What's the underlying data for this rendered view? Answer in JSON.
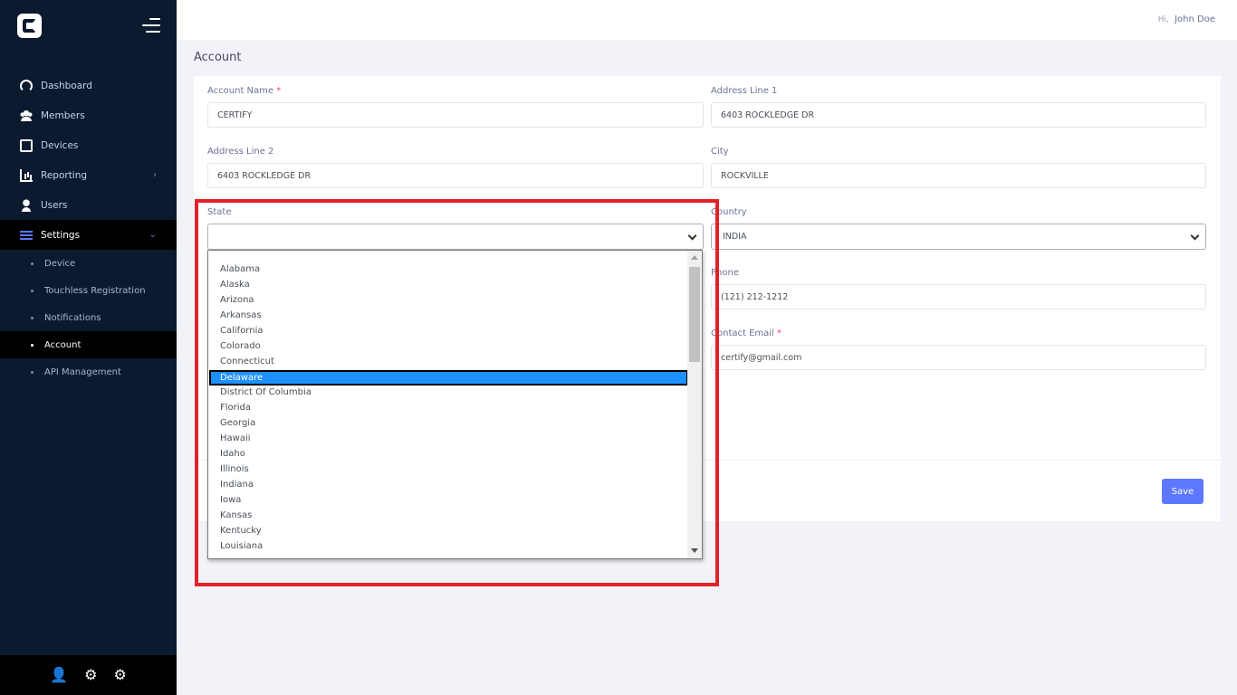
{
  "sidebar": {
    "nav": [
      {
        "label": "Dashboard",
        "icon": "dashboard-icon"
      },
      {
        "label": "Members",
        "icon": "members-icon"
      },
      {
        "label": "Devices",
        "icon": "devices-icon"
      },
      {
        "label": "Reporting",
        "icon": "reporting-icon",
        "chevron": "›"
      },
      {
        "label": "Users",
        "icon": "users-icon"
      },
      {
        "label": "Settings",
        "icon": "settings-icon",
        "chevron": "⌄"
      }
    ],
    "settings_sub": [
      "Device",
      "Touchless Registration",
      "Notifications",
      "Account",
      "API Management"
    ],
    "active_sub": "Account",
    "footer_icons": [
      "user-gear-icon",
      "gears-icon",
      "cog-icon"
    ]
  },
  "header": {
    "hi": "Hi,",
    "user_name": "John Doe"
  },
  "page": {
    "title": "Account"
  },
  "form": {
    "account_name": {
      "label": "Account Name",
      "required": "*",
      "value": "CERTIFY"
    },
    "address1": {
      "label": "Address Line 1",
      "value": "6403 ROCKLEDGE DR"
    },
    "address2": {
      "label": "Address Line 2",
      "value": "6403 ROCKLEDGE DR"
    },
    "city": {
      "label": "City",
      "value": "ROCKVILLE"
    },
    "state": {
      "label": "State",
      "value": ""
    },
    "country": {
      "label": "Country",
      "value": "INDIA"
    },
    "phone": {
      "label": "Phone",
      "value": "(121) 212-1212"
    },
    "contact_email": {
      "label": "Contact Email",
      "required": "*",
      "value": "certify@gmail.com"
    },
    "save_label": "Save"
  },
  "state_options": [
    "Alabama",
    "Alaska",
    "Arizona",
    "Arkansas",
    "California",
    "Colorado",
    "Connecticut",
    "Delaware",
    "District Of Columbia",
    "Florida",
    "Georgia",
    "Hawaii",
    "Idaho",
    "Illinois",
    "Indiana",
    "Iowa",
    "Kansas",
    "Kentucky",
    "Louisiana"
  ],
  "state_highlighted": "Delaware",
  "colors": {
    "sidebar_bg": "#0b1a2e",
    "accent": "#5d78ff",
    "highlight_border": "#e2202a",
    "option_selected": "#1e90ff"
  }
}
